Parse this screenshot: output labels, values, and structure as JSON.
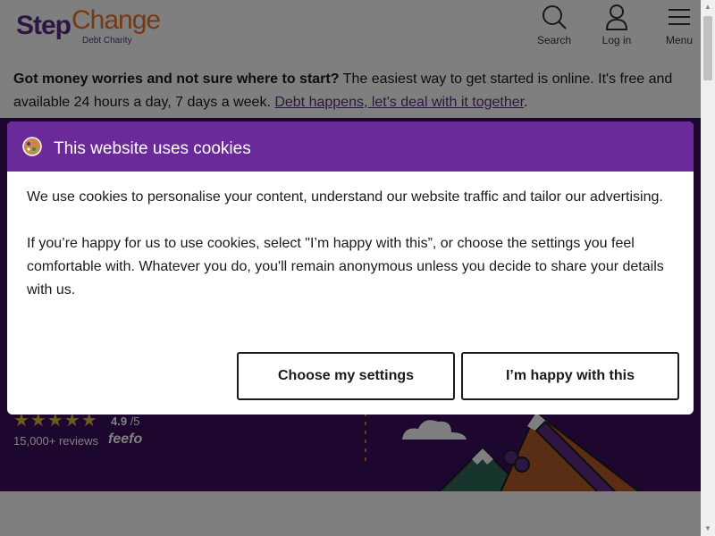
{
  "brand": {
    "logo_step": "Step",
    "logo_change": "Change",
    "logo_sub": "Debt Charity",
    "primary_color": "#5b2c86",
    "accent_color": "#e8752a"
  },
  "nav": {
    "search_label": "Search",
    "login_label": "Log in",
    "menu_label": "Menu"
  },
  "notice": {
    "bold_text": "Got money worries and not sure where to start?",
    "body_text": " The easiest way to get started is online. It's free and available 24 hours a day, 7 days a week. ",
    "link_text": "Debt happens, let's deal with it together",
    "end_text": "."
  },
  "hero": {
    "stars": "★★★★★",
    "rating_value": "4.9",
    "rating_max": " /5",
    "reviews_text": "15,000+ reviews",
    "feefo_label": "feefo",
    "background_color": "#3a0e5c"
  },
  "cookie_modal": {
    "title": "This website uses cookies",
    "paragraph_1": "We use cookies to personalise your content, understand our website traffic and tailor our advertising.",
    "paragraph_2": "If you’re happy for us to use cookies, select \"I’m happy with this”, or choose the settings you feel comfortable with. Whatever you do, you'll remain anonymous unless you decide to share your details with us.",
    "settings_button": "Choose my settings",
    "accept_button": "I’m happy with this",
    "header_color": "#6a2a9a"
  }
}
